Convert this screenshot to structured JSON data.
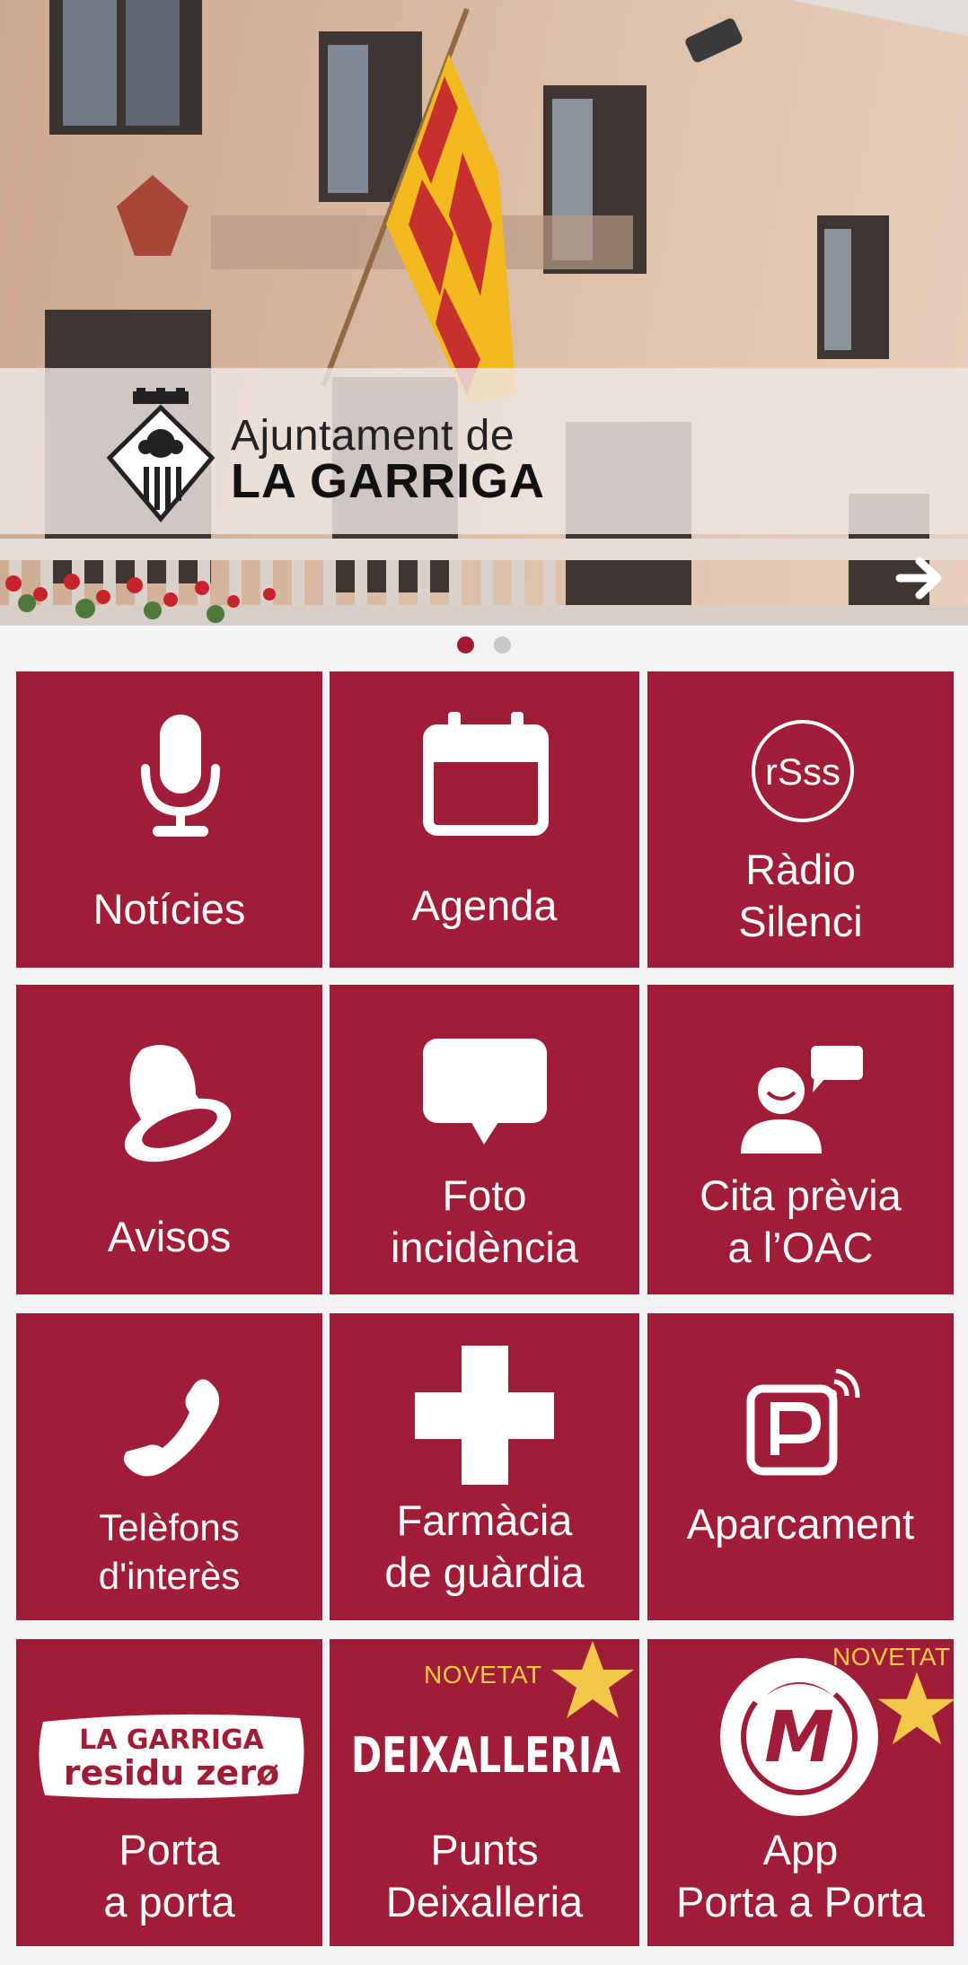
{
  "banner": {
    "logo_line1": "Ajuntament de",
    "logo_line2": "LA GARRIGA",
    "next_icon": "arrow-right-icon"
  },
  "carousel": {
    "slides": 2,
    "active_index": 0
  },
  "colors": {
    "tile": "#a11c36",
    "badge": "#f2c84a",
    "background": "#f4f4f6"
  },
  "tiles": [
    {
      "label": "Notícies",
      "icon": "microphone-icon"
    },
    {
      "label": "Agenda",
      "icon": "calendar-icon"
    },
    {
      "label": "Ràdio\nSilenci",
      "icon": "radio-silenci-logo",
      "icon_text": "rSss"
    },
    {
      "label": "Avisos",
      "icon": "bell-icon"
    },
    {
      "label": "Foto\nincidència",
      "icon": "speech-bubble-icon"
    },
    {
      "label": "Cita prèvia\na l’OAC",
      "icon": "user-chat-icon"
    },
    {
      "label": "Telèfons\nd'interès",
      "icon": "phone-icon"
    },
    {
      "label": "Farmàcia\nde guàrdia",
      "icon": "pharmacy-cross-icon"
    },
    {
      "label": "Aparcament",
      "icon": "parking-icon"
    },
    {
      "label": "Porta\na porta",
      "icon": "residu-zero-logo",
      "logo_line1": "LA GARRIGA",
      "logo_line2": "residu zerø"
    },
    {
      "label": "Punts\nDeixalleria",
      "icon": "deixalleria-logo",
      "logo_text": "DEIXALLERIA",
      "badge": "NOVETAT",
      "badge_icon": "star-icon"
    },
    {
      "label": "App\nPorta a Porta",
      "icon": "app-m-logo",
      "logo_text": "M",
      "badge": "NOVETAT",
      "badge_icon": "star-icon"
    }
  ]
}
